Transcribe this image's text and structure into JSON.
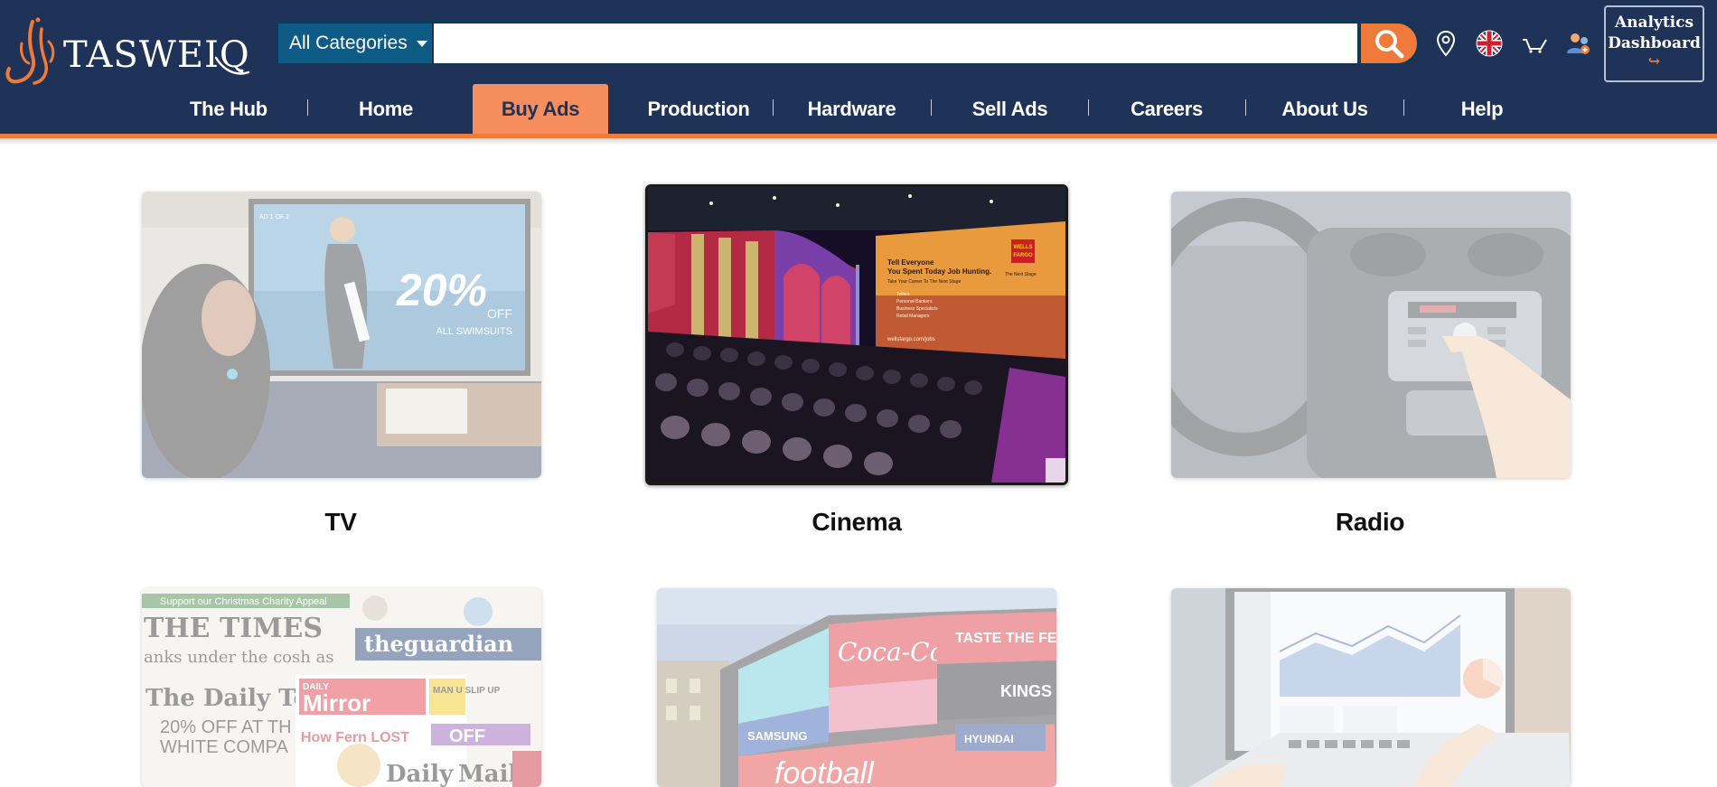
{
  "brand": {
    "name": "TASWEIQ",
    "accent": "#f07a3a",
    "navy": "#1f3358"
  },
  "search": {
    "category_label": "All Categories",
    "placeholder": "",
    "value": ""
  },
  "header_icons": [
    "location-pin-icon",
    "uk-flag-icon",
    "cart-icon",
    "user-icon"
  ],
  "analytics": {
    "line1": "Analytics",
    "line2": "Dashboard",
    "arrow": "↪"
  },
  "nav": {
    "items": [
      {
        "label": "The Hub",
        "active": false
      },
      {
        "label": "Home",
        "active": false
      },
      {
        "label": "Buy Ads",
        "active": true
      },
      {
        "label": "Production",
        "active": false
      },
      {
        "label": "Hardware",
        "active": false
      },
      {
        "label": "Sell Ads",
        "active": false
      },
      {
        "label": "Careers",
        "active": false
      },
      {
        "label": "About Us",
        "active": false
      },
      {
        "label": "Help",
        "active": false
      }
    ]
  },
  "categories": [
    {
      "label": "TV",
      "image": "tv-ad-image",
      "image_text": {
        "tag": "AD 1 OF 2",
        "big": "20%",
        "small": "OFF",
        "sub": "ALL SWIMSUITS"
      }
    },
    {
      "label": "Cinema",
      "image": "cinema-ad-image",
      "image_text": {
        "brand1": "WELLS",
        "brand2": "FARGO",
        "line1": "Tell Everyone",
        "line2": "You Spent Today Job Hunting.",
        "line3": "Take Your Career To The Next Stage",
        "b1": "Tellers",
        "b2": "Personal Bankers",
        "b3": "Business Specialists",
        "b4": "Retail Managers",
        "url": "wellsfargo.com/jobs",
        "tagline": "The Next Stage"
      }
    },
    {
      "label": "Radio",
      "image": "radio-ad-image"
    },
    {
      "label": "",
      "image": "newspaper-ad-image",
      "image_text": {
        "banner": "Support our Christmas Charity Appeal",
        "t1": "THE TIMES",
        "t1b": "anks under the cosh as",
        "t2": "theguardian",
        "t3": "The Daily Tel",
        "t3b": "20% OFF AT TH",
        "t3c": "WHITE COMPA",
        "t4a": "DAILY",
        "t4": "Mirror",
        "t4b": "MAN U SLIP UP",
        "t4c": "OFF",
        "t5": "Daily",
        "t5b": "Mail",
        "t6": "How Fern LOST"
      }
    },
    {
      "label": "",
      "image": "billboard-ad-image",
      "image_text": {
        "b1": "Coca-Cola",
        "b2": "TASTE THE FEE",
        "b3": "SAMSUNG",
        "b4": "KINGS LONDO",
        "b5": "football",
        "b6": "HYUNDAI"
      }
    },
    {
      "label": "",
      "image": "online-ad-image"
    }
  ]
}
